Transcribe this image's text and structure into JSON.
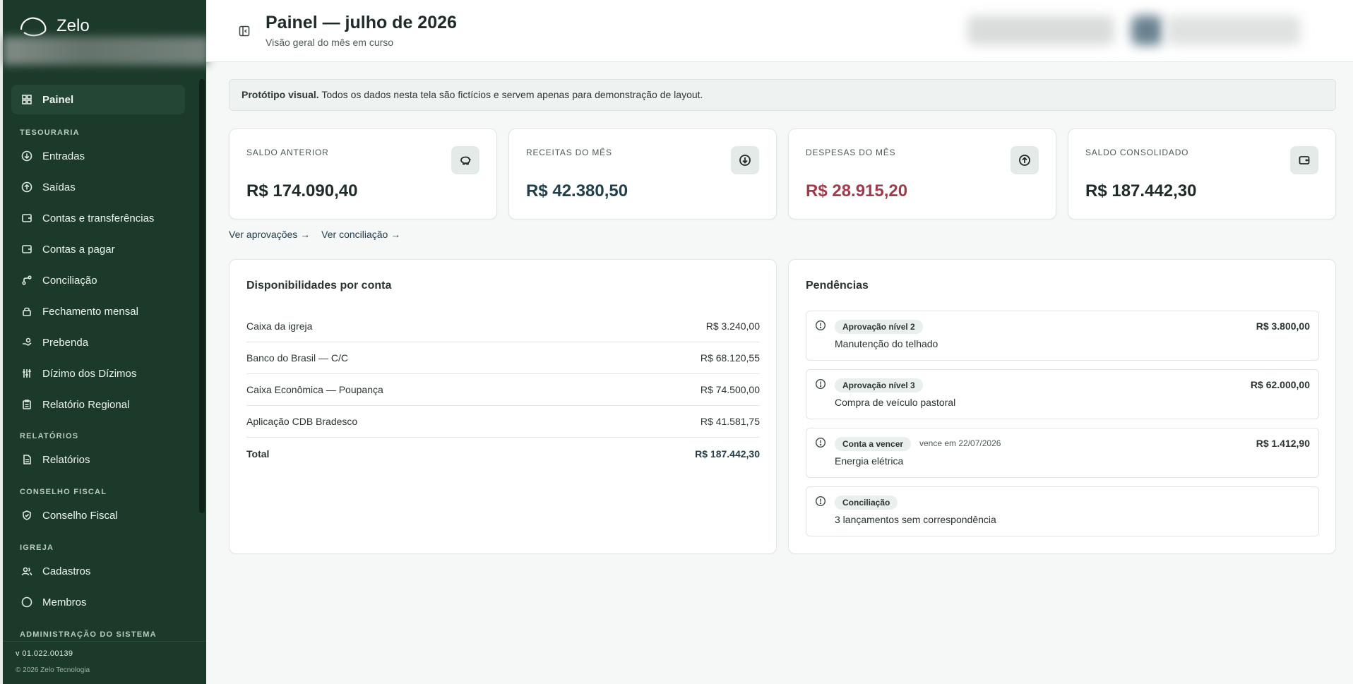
{
  "brand": {
    "name": "Zelo"
  },
  "sidebar": {
    "items": [
      {
        "key": "painel",
        "label": "Painel",
        "icon": "grid-icon"
      },
      {
        "key": "entradas",
        "label": "Entradas",
        "icon": "arrow-down-circle-icon"
      },
      {
        "key": "saidas",
        "label": "Saídas",
        "icon": "arrow-up-circle-icon"
      },
      {
        "key": "contas-transf",
        "label": "Contas e transferências",
        "icon": "wallet-icon"
      },
      {
        "key": "contas-pagar",
        "label": "Contas a pagar",
        "icon": "wallet-icon"
      },
      {
        "key": "conciliacao",
        "label": "Conciliação",
        "icon": "route-icon"
      },
      {
        "key": "fechamento",
        "label": "Fechamento mensal",
        "icon": "lock-icon"
      },
      {
        "key": "prebenda",
        "label": "Prebenda",
        "icon": "hand-coins-icon"
      },
      {
        "key": "dizimo",
        "label": "Dízimo dos Dízimos",
        "icon": "sliders-icon"
      },
      {
        "key": "relatorio-regional",
        "label": "Relatório Regional",
        "icon": "clipboard-icon"
      },
      {
        "key": "relatorios",
        "label": "Relatórios",
        "icon": "file-icon"
      },
      {
        "key": "conselho",
        "label": "Conselho Fiscal",
        "icon": "shield-check-icon"
      },
      {
        "key": "cadastros",
        "label": "Cadastros",
        "icon": "users-icon"
      },
      {
        "key": "membros",
        "label": "Membros",
        "icon": "circle-icon"
      }
    ],
    "sections": {
      "tesouraria": "TESOURARIA",
      "relatorios": "RELATÓRIOS",
      "conselho": "CONSELHO FISCAL",
      "igreja": "IGREJA",
      "admin": "ADMINISTRAÇÃO DO SISTEMA"
    },
    "version": "v 01.022.00139",
    "copyright": "© 2026 Zelo Tecnologia"
  },
  "header": {
    "title": "Painel — julho de 2026",
    "subtitle": "Visão geral do mês em curso"
  },
  "notice": {
    "bold": "Protótipo visual.",
    "text": " Todos os dados nesta tela são fictícios e servem apenas para demonstração de layout."
  },
  "kpis": [
    {
      "label": "SALDO ANTERIOR",
      "value": "R$ 174.090,40",
      "icon": "piggy-bank-icon"
    },
    {
      "label": "RECEITAS DO MÊS",
      "value": "R$ 42.380,50",
      "icon": "arrow-down-circle-icon"
    },
    {
      "label": "DESPESAS DO MÊS",
      "value": "R$ 28.915,20",
      "icon": "arrow-up-circle-icon"
    },
    {
      "label": "SALDO CONSOLIDADO",
      "value": "R$ 187.442,30",
      "icon": "wallet-icon"
    }
  ],
  "links": {
    "approvals": "Ver aprovações →",
    "reconciliation": "Ver conciliação →"
  },
  "accounts": {
    "title": "Disponibilidades por conta",
    "rows": [
      {
        "name": "Caixa da igreja",
        "amount": "R$ 3.240,00"
      },
      {
        "name": "Banco do Brasil — C/C",
        "amount": "R$ 68.120,55"
      },
      {
        "name": "Caixa Econômica — Poupança",
        "amount": "R$ 74.500,00"
      },
      {
        "name": "Aplicação CDB Bradesco",
        "amount": "R$ 41.581,75"
      }
    ],
    "total_label": "Total",
    "total_amount": "R$ 187.442,30"
  },
  "pending": {
    "title": "Pendências",
    "items": [
      {
        "badge": "Aprovação nível 2",
        "due": "",
        "desc": "Manutenção do telhado",
        "amount": "R$ 3.800,00"
      },
      {
        "badge": "Aprovação nível 3",
        "due": "",
        "desc": "Compra de veículo pastoral",
        "amount": "R$ 62.000,00"
      },
      {
        "badge": "Conta a vencer",
        "due": "vence em 22/07/2026",
        "desc": "Energia elétrica",
        "amount": "R$ 1.412,90"
      },
      {
        "badge": "Conciliação",
        "due": "",
        "desc": "3 lançamentos sem correspondência",
        "amount": ""
      }
    ]
  },
  "colors": {
    "sidebar": "#1c3a2a",
    "active": "#244635",
    "income": "#22404c",
    "expense": "#a33a4b"
  }
}
